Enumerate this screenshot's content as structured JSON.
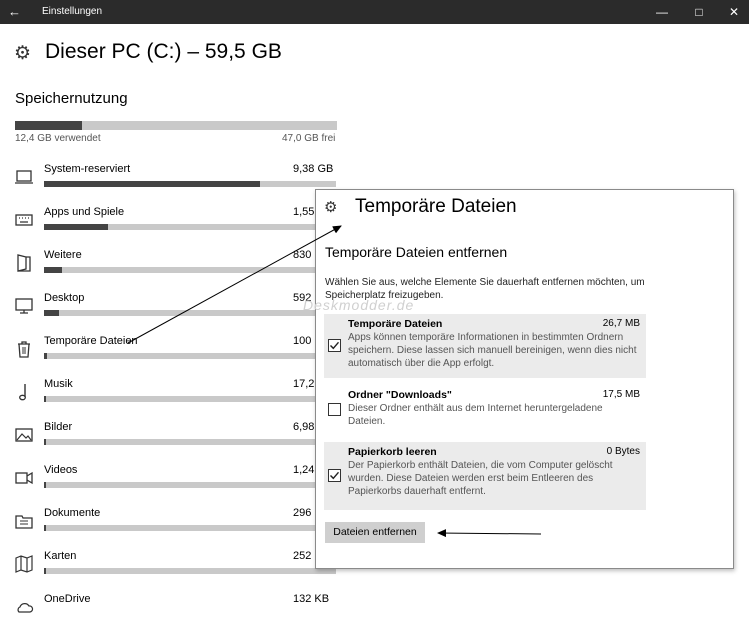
{
  "window": {
    "back_icon": "arrow-left-icon",
    "title": "Einstellungen",
    "minimize": "—",
    "maximize": "□",
    "close": "✕"
  },
  "header": {
    "title": "Dieser PC (C:) – 59,5 GB",
    "icon": "gear-icon"
  },
  "storage": {
    "section_title": "Speichernutzung",
    "used_label": "12,4 GB verwendet",
    "free_label": "47,0 GB frei",
    "used_fraction": 0.208
  },
  "categories": [
    {
      "label": "System-reserviert",
      "size": "9,38 GB",
      "fraction": 0.74,
      "icon": "laptop-icon"
    },
    {
      "label": "Apps und Spiele",
      "size": "1,55",
      "fraction": 0.22,
      "icon": "keyboard-icon"
    },
    {
      "label": "Weitere",
      "size": "830",
      "fraction": 0.06,
      "icon": "door-icon"
    },
    {
      "label": "Desktop",
      "size": "592",
      "fraction": 0.05,
      "icon": "monitor-icon"
    },
    {
      "label": "Temporäre Dateien",
      "size": "100",
      "fraction": 0.01,
      "icon": "trash-icon"
    },
    {
      "label": "Musik",
      "size": "17,2",
      "fraction": 0.007,
      "icon": "music-note-icon"
    },
    {
      "label": "Bilder",
      "size": "6,98",
      "fraction": 0.007,
      "icon": "picture-icon"
    },
    {
      "label": "Videos",
      "size": "1,24",
      "fraction": 0.007,
      "icon": "video-camera-icon"
    },
    {
      "label": "Dokumente",
      "size": "296",
      "fraction": 0.007,
      "icon": "documents-icon"
    },
    {
      "label": "Karten",
      "size": "252",
      "fraction": 0.007,
      "icon": "map-icon"
    },
    {
      "label": "OneDrive",
      "size": "132 KB",
      "fraction": 0.0,
      "icon": "cloud-icon"
    }
  ],
  "panel": {
    "title": "Temporäre Dateien",
    "icon": "gear-icon",
    "subtitle": "Temporäre Dateien entfernen",
    "description": "Wählen Sie aus, welche Elemente Sie dauerhaft entfernen möchten, um Speicherplatz freizugeben.",
    "items": [
      {
        "name": "Temporäre Dateien",
        "size": "26,7 MB",
        "checked": true,
        "description": "Apps können temporäre Informationen in bestimmten Ordnern speichern. Diese lassen sich manuell bereinigen, wenn dies nicht automatisch über die App erfolgt."
      },
      {
        "name": "Ordner \"Downloads\"",
        "size": "17,5 MB",
        "checked": false,
        "description": "Dieser Ordner enthält aus dem Internet heruntergeladene Dateien."
      },
      {
        "name": "Papierkorb leeren",
        "size": "0 Bytes",
        "checked": true,
        "description": "Der Papierkorb enthält Dateien, die vom Computer gelöscht wurden. Diese Dateien werden erst beim Entleeren des Papierkorbs dauerhaft entfernt."
      }
    ],
    "button_label": "Dateien entfernen"
  },
  "watermark": "Deskmodder.de"
}
